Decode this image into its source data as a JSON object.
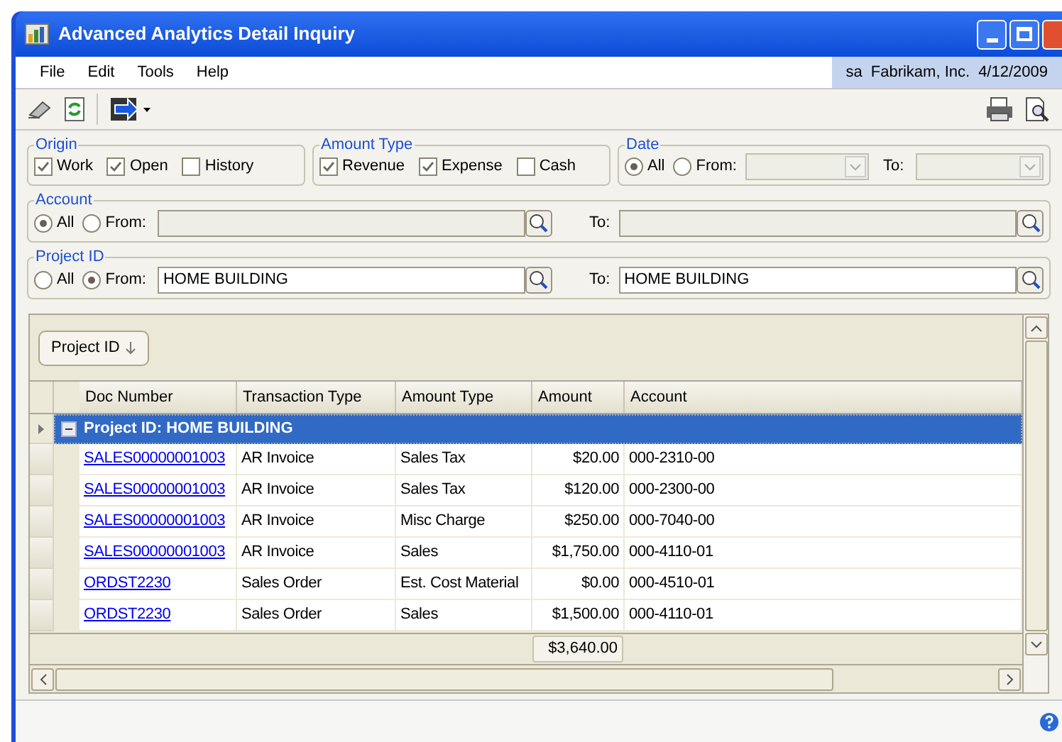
{
  "window": {
    "title": "Advanced Analytics Detail Inquiry"
  },
  "menu": [
    "File",
    "Edit",
    "Tools",
    "Help"
  ],
  "session": {
    "user": "sa",
    "company": "Fabrikam, Inc.",
    "date": "4/12/2009"
  },
  "origin": {
    "label": "Origin",
    "options": [
      {
        "label": "Work",
        "checked": true
      },
      {
        "label": "Open",
        "checked": true
      },
      {
        "label": "History",
        "checked": false
      }
    ]
  },
  "amount_type": {
    "label": "Amount Type",
    "options": [
      {
        "label": "Revenue",
        "checked": true
      },
      {
        "label": "Expense",
        "checked": true
      },
      {
        "label": "Cash",
        "checked": false
      }
    ]
  },
  "date": {
    "label": "Date",
    "options": [
      {
        "label": "All",
        "selected": true
      },
      {
        "label": "From:",
        "selected": false
      }
    ],
    "to_label": "To:"
  },
  "account": {
    "label": "Account",
    "options": [
      {
        "label": "All",
        "selected": true
      },
      {
        "label": "From:",
        "selected": false
      }
    ],
    "to_label": "To:"
  },
  "project_id": {
    "label": "Project ID",
    "options": [
      {
        "label": "All",
        "selected": false
      },
      {
        "label": "From:",
        "selected": true
      }
    ],
    "from_value": "HOME BUILDING",
    "to_label": "To:",
    "to_value": "HOME BUILDING"
  },
  "grid": {
    "group_by": "Project ID",
    "columns": [
      "Doc Number",
      "Transaction Type",
      "Amount Type",
      "Amount",
      "Account"
    ],
    "group": {
      "label": "Project ID: HOME BUILDING",
      "expanded": true
    },
    "rows": [
      [
        "SALES00000001003",
        "AR Invoice",
        "Sales Tax",
        "$20.00",
        "000-2310-00"
      ],
      [
        "SALES00000001003",
        "AR Invoice",
        "Sales Tax",
        "$120.00",
        "000-2300-00"
      ],
      [
        "SALES00000001003",
        "AR Invoice",
        "Misc Charge",
        "$250.00",
        "000-7040-00"
      ],
      [
        "SALES00000001003",
        "AR Invoice",
        "Sales",
        "$1,750.00",
        "000-4110-01"
      ],
      [
        "ORDST2230",
        "Sales Order",
        "Est. Cost Material",
        "$0.00",
        "000-4510-01"
      ],
      [
        "ORDST2230",
        "Sales Order",
        "Sales",
        "$1,500.00",
        "000-4110-01"
      ]
    ],
    "total": "$3,640.00"
  }
}
